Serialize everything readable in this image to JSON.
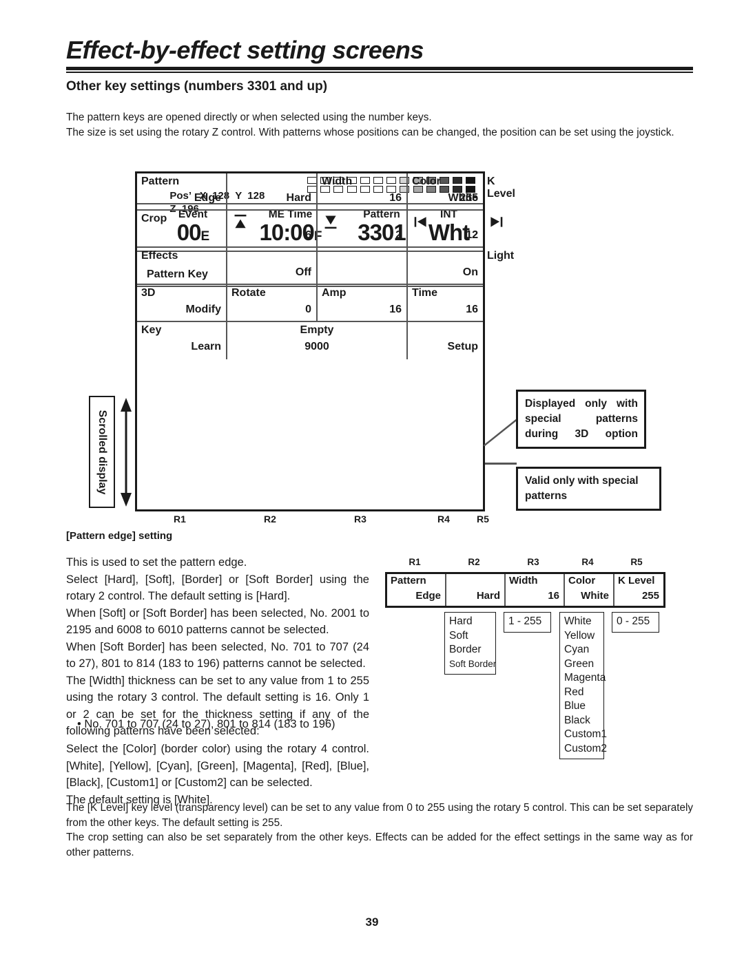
{
  "header": {
    "chapter_title": "Effect-by-effect setting screens",
    "section_title": "Other key settings (numbers 3301 and up)",
    "intro_line1": "The pattern keys are opened directly or when selected using the number keys.",
    "intro_line2": "The size is set using the rotary Z control.  With patterns whose positions can be changed, the position can be set using the joystick."
  },
  "panel": {
    "pos": {
      "label": "Pos’",
      "x_label": "X",
      "x_value": "128",
      "y_label": "Y",
      "y_value": "128",
      "z_label": "Z",
      "z_value": "196",
      "bar_steps": 13
    },
    "status": {
      "event_caption": "Event",
      "event_value": "00",
      "event_suffix": "E",
      "metime_caption": "ME Time",
      "metime_value": "10:00",
      "metime_suffix": "F",
      "pattern_caption": "Pattern",
      "pattern_value": "3301",
      "pattern_suffix": "",
      "int_caption": "INT",
      "int_value": "Wht",
      "int_suffix": ""
    },
    "pattern_key_label": "Pattern Key",
    "rows": [
      {
        "name": "pattern",
        "cells": [
          {
            "top": "Pattern",
            "bottom": "Edge"
          },
          {
            "top": "",
            "bottom": "Hard"
          },
          {
            "top": "Width",
            "bottom": "16"
          },
          {
            "top": "Color",
            "bottom": "White"
          },
          {
            "top": "K Level",
            "bottom": "255"
          }
        ]
      },
      {
        "name": "crop",
        "cells": [
          {
            "top": "Crop",
            "bottom": ""
          },
          {
            "icon": "crop-top-icon",
            "bottom": "6"
          },
          {
            "icon": "crop-bottom-icon",
            "bottom": "2"
          },
          {
            "icon": "crop-left-icon",
            "bottom": "12"
          },
          {
            "icon": "crop-right-icon",
            "bottom": "12"
          }
        ]
      },
      {
        "name": "effects",
        "cells": [
          {
            "top": "Effects",
            "bottom": ""
          },
          {
            "top": "",
            "bottom": "Off"
          },
          {
            "top": "",
            "bottom": ""
          },
          {
            "top": "",
            "bottom": ""
          },
          {
            "top": "Light",
            "bottom": "On"
          }
        ]
      },
      {
        "name": "3d",
        "cells": [
          {
            "top": "3D",
            "bottom": "Modify"
          },
          {
            "top": "Rotate",
            "bottom": "0"
          },
          {
            "top": "Amp",
            "bottom": "16"
          },
          {
            "top": "Time",
            "bottom": "16"
          },
          {
            "top": "",
            "bottom": ""
          }
        ]
      },
      {
        "name": "key",
        "cells": [
          {
            "top": "Key",
            "bottom": "Learn"
          },
          {
            "top": "Empty",
            "bottom": "9000"
          },
          {
            "top": "",
            "bottom": "Setup"
          },
          {
            "top": "",
            "bottom": ""
          }
        ]
      }
    ],
    "r_labels": [
      "R1",
      "R2",
      "R3",
      "R4",
      "R5"
    ]
  },
  "scrolled_display_label": "Scrolled display",
  "callouts": [
    {
      "lines": [
        "Displayed only with",
        "special        patterns",
        "during 3D option"
      ]
    },
    {
      "lines": [
        "Valid only with special",
        "patterns"
      ]
    }
  ],
  "body": {
    "subhead": "[Pattern edge] setting",
    "para1": [
      "This is used to set the pattern edge.",
      "Select [Hard], [Soft], [Border] or [Soft Border] using the rotary 2 control.  The default setting is [Hard].",
      "When [Soft] or [Soft Border] has been selected, No. 2001 to 2195 and 6008 to 6010 patterns cannot be selected.",
      "When [Soft Border] has been selected, No. 701 to 707 (24 to 27), 801 to 814 (183 to 196) patterns cannot be selected.",
      "The [Width] thickness can be set to any value from 1 to 255 using the rotary 3 control.  The default setting is 16.  Only 1 or 2 can be set for the thickness setting if any of the following patterns have been selected:"
    ],
    "bullet": "• No. 701 to 707 (24 to 27), 801 to 814 (183 to 196)",
    "para2": [
      "Select the [Color] (border color) using the rotary 4 control.  [White], [Yellow], [Cyan], [Green], [Magenta], [Red], [Blue], [Black], [Custom1] or [Custom2] can be selected.",
      "The default setting is [White]."
    ],
    "para3": [
      "The [K Level] key level (transparency level) can be set to any value from 0 to 255 using the rotary 5 control.  This can be set separately from the other keys.  The default setting is 255.",
      "The crop setting can also be set separately from the other keys.  Effects can be added for the effect settings in the same way as for other patterns."
    ]
  },
  "mini_diagram": {
    "r_labels": [
      "R1",
      "R2",
      "R3",
      "R4",
      "R5"
    ],
    "cells": [
      {
        "top": "Pattern",
        "bottom": "Edge"
      },
      {
        "top": "",
        "bottom": "Hard"
      },
      {
        "top": "Width",
        "bottom": "16"
      },
      {
        "top": "Color",
        "bottom": "White"
      },
      {
        "top": "K Level",
        "bottom": "255"
      }
    ],
    "edge_options": [
      "Hard",
      "Soft",
      "Border",
      "Soft Border"
    ],
    "width_range": "1 - 255",
    "color_options": [
      "White",
      "Yellow",
      "Cyan",
      "Green",
      "Magenta",
      "Red",
      "Blue",
      "Black",
      "Custom1",
      "Custom2"
    ],
    "klevel_range": "0 - 255"
  },
  "page_number": "39"
}
